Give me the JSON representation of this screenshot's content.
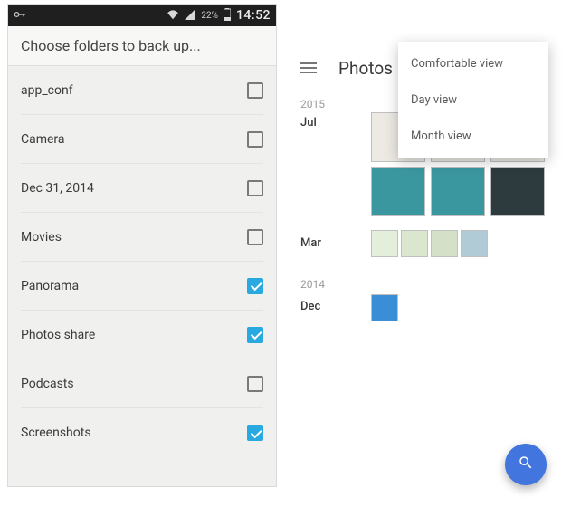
{
  "left": {
    "statusbar": {
      "battery_pct": "22%",
      "clock": "14:52"
    },
    "title": "Choose folders to back up...",
    "folders": [
      {
        "label": "app_conf",
        "checked": false
      },
      {
        "label": "Camera",
        "checked": false
      },
      {
        "label": "Dec 31, 2014",
        "checked": false
      },
      {
        "label": "Movies",
        "checked": false
      },
      {
        "label": "Panorama",
        "checked": true
      },
      {
        "label": "Photos share",
        "checked": true
      },
      {
        "label": "Podcasts",
        "checked": false
      },
      {
        "label": "Screenshots",
        "checked": true
      }
    ]
  },
  "right": {
    "header_title": "Photos",
    "menu_items": [
      "Comfortable view",
      "Day view",
      "Month view"
    ],
    "sections": {
      "year1": "2015",
      "month_jul": "Jul",
      "month_mar": "Mar",
      "year2": "2014",
      "month_dec": "Dec"
    }
  }
}
